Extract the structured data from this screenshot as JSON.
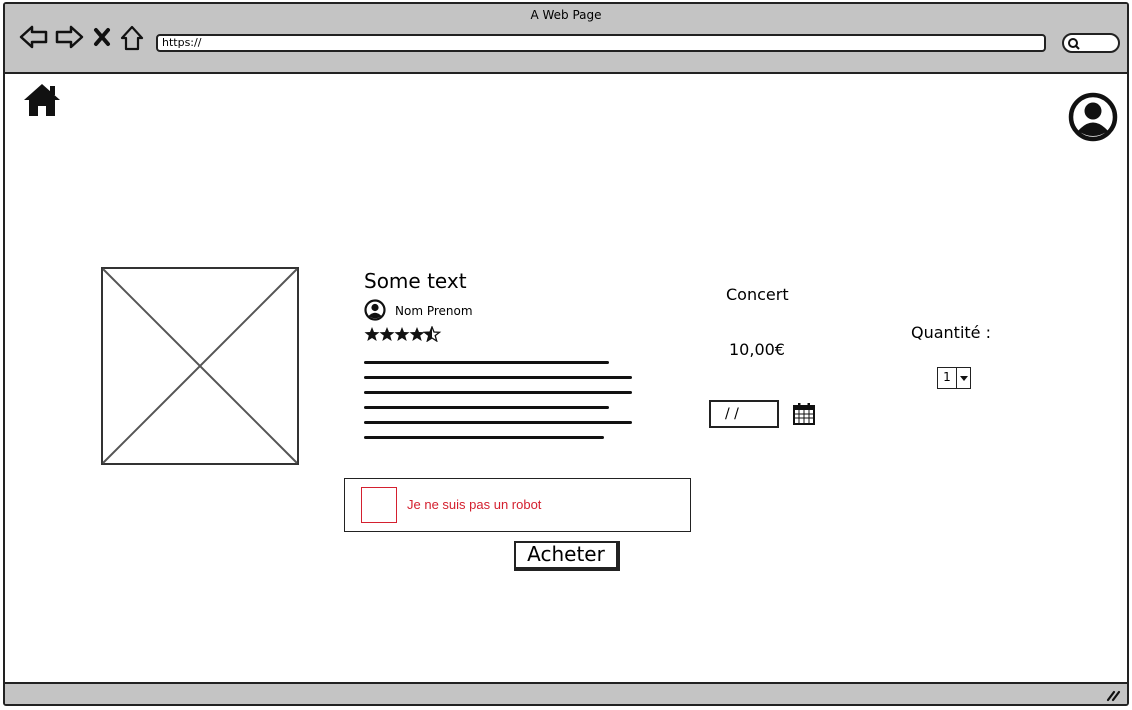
{
  "window": {
    "title": "A Web Page"
  },
  "browser": {
    "url": "https://"
  },
  "product": {
    "title": "Some text",
    "author": "Nom Prenom",
    "rating": 4.5,
    "rating_max": 5,
    "category": "Concert",
    "price": "10,00€",
    "date_placeholder": "/ /"
  },
  "quantity": {
    "label": "Quantité :",
    "value": "1"
  },
  "captcha": {
    "label": "Je ne suis pas un robot"
  },
  "buy_button": {
    "label": "Acheter"
  },
  "icons": [
    "back-icon",
    "forward-icon",
    "close-icon",
    "home-icon",
    "search-icon",
    "user-icon",
    "calendar-icon",
    "chevron-down-icon",
    "resize-grip-icon"
  ],
  "colors": {
    "chrome": "#c4c4c4",
    "captcha_red": "#d4202f",
    "stroke": "#222222"
  }
}
